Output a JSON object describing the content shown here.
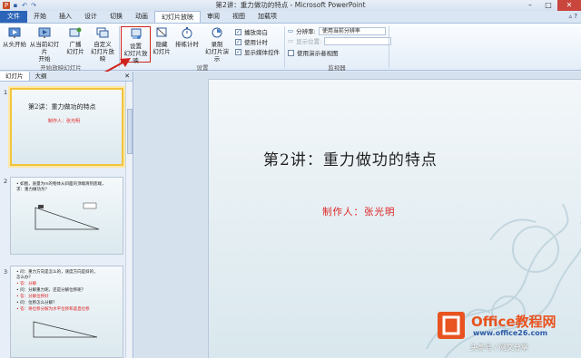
{
  "titlebar": {
    "title": "第2讲：重力做功的特点 - Microsoft PowerPoint",
    "qat_icons": [
      "powerpoint-icon",
      "save-icon",
      "undo-icon",
      "redo-icon"
    ]
  },
  "tabs": [
    "文件",
    "开始",
    "插入",
    "设计",
    "切换",
    "动画",
    "幻灯片放映",
    "审阅",
    "视图",
    "加载项"
  ],
  "ribbon": {
    "from_start": "从头开始",
    "from_current_l1": "从当前幻灯片",
    "from_current_l2": "开始",
    "broadcast_l1": "广播",
    "broadcast_l2": "幻灯片",
    "custom_l1": "自定义",
    "custom_l2": "幻灯片放映",
    "group_start": "开始放映幻灯片",
    "setup_l1": "设置",
    "setup_l2": "幻灯片放映",
    "hide_l1": "隐藏",
    "hide_l2": "幻灯片",
    "rehearse": "排练计时",
    "record_l1": "录制",
    "record_l2": "幻灯片演示",
    "chk_narration": "播放旁白",
    "chk_timing": "使用计时",
    "chk_media": "显示媒体控件",
    "group_setup": "设置",
    "resolution_label": "分辨率:",
    "resolution_value": "使用当前分辨率",
    "show_on_label": "显示位置:",
    "presenter_view": "使用演示者视图",
    "group_monitor": "监视器"
  },
  "panel": {
    "tab_slides": "幻灯片",
    "tab_outline": "大纲",
    "slides": [
      {
        "num": "1",
        "title": "第2讲：重力做功的特点",
        "author": "制作人：张光明"
      },
      {
        "num": "2",
        "lines": [
          "• 如图，质量为m的物体从斜面的顶端滑到底端，",
          "  求：重力做功为？"
        ]
      },
      {
        "num": "3",
        "lines": [
          "• 问：重力方向是怎么的，速度方向是斜的，",
          "  怎么办？",
          "• 答：分解",
          "• 问：分解重力呢，还是分解位移呢？",
          "• 答：分解位移好",
          "• 问：位移怎么分解？",
          "• 答：将位移分解为水平位移和竖直位移"
        ]
      }
    ]
  },
  "slide": {
    "title": "第2讲：重力做功的特点",
    "subtitle": "制作人：张光明"
  },
  "watermark": {
    "brand": "Office教程网",
    "url": "www.office26.com",
    "footer": "头条号 / 网文分享"
  }
}
